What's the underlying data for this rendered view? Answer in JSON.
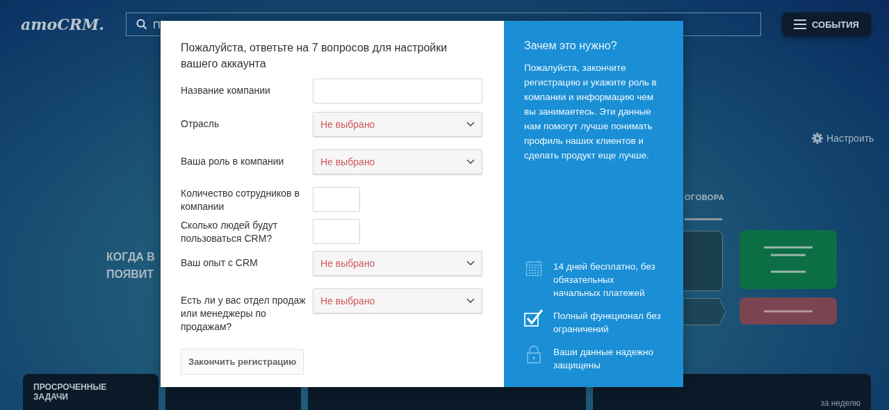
{
  "header": {
    "logo": "amoCRM.",
    "search": {
      "placeholder": "П"
    },
    "events_button": "СОБЫТИЯ"
  },
  "dashboard": {
    "settings_link": "Настроить",
    "banner_lines": [
      "КОГДА В",
      "ПОЯВИТ"
    ],
    "stage_tab": "ОГОВОРА",
    "widgets": [
      {
        "kind": "card",
        "title": "ПРОСРОЧЕННЫЕ ЗАДАЧИ"
      },
      {
        "kind": "card"
      },
      {
        "kind": "card"
      },
      {
        "kind": "card",
        "note": "за неделю"
      }
    ]
  },
  "modal": {
    "title": "Пожалуйста, ответьте на 7 вопросов для настройки вашего аккаунта",
    "fields": [
      {
        "label": "Название компании",
        "kind": "text"
      },
      {
        "label": "Отрасль",
        "kind": "select",
        "value": "Не выбрано"
      },
      {
        "label": "Ваша роль в компании",
        "kind": "select",
        "value": "Не выбрано"
      },
      {
        "label": "Количество сотрудников в компании",
        "kind": "short"
      },
      {
        "label": "Сколько людей будут пользоваться CRM?",
        "kind": "short"
      },
      {
        "label": "Ваш опыт с CRM",
        "kind": "select",
        "value": "Не выбрано"
      },
      {
        "label": "Есть ли у вас отдел продаж или менеджеры по продажам?",
        "kind": "select",
        "value": "Не выбрано"
      }
    ],
    "submit_button": "Закончить регистрацию",
    "side": {
      "heading": "Зачем это нужно?",
      "text": "Пожалуйста, закончите регистрацию и укажите роль в компании и информацию чем вы занимаетесь. Эти данные нам помогут лучше понимать профиль наших клиентов и сделать продукт еще лучше.",
      "benefits": [
        "14 дней бесплатно, без обязательных начальных платежей",
        "Полный функционал без ограничений",
        "Ваши данные надежно защищены"
      ]
    }
  }
}
